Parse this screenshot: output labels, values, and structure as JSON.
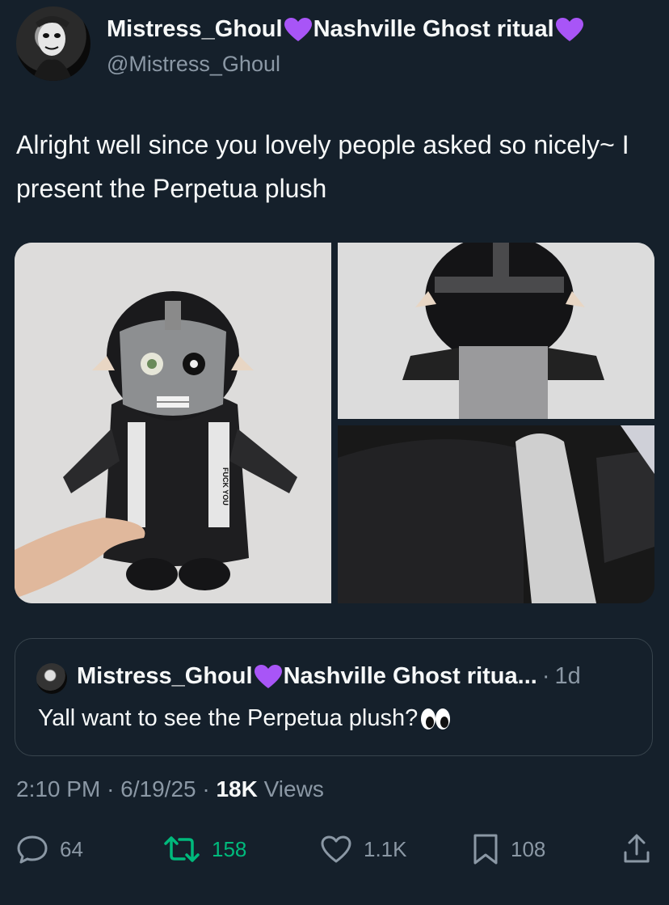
{
  "tweet": {
    "display_name": "Mistress_Ghoul",
    "display_name_suffix": "Nashville Ghost ritual",
    "handle": "@Mistress_Ghoul",
    "text": "Alright well since you lovely people asked so nicely~ I present the Perpetua plush",
    "timestamp": "2:10 PM",
    "date": "6/19/25",
    "views_count": "18K",
    "views_label": "Views"
  },
  "media": {
    "label_text": "FUCK YOU"
  },
  "quote": {
    "display_name": "Mistress_Ghoul",
    "display_name_suffix": "Nashville Ghost ritua...",
    "age": "1d",
    "text": "Yall want to see the Perpetua plush?"
  },
  "actions": {
    "replies": "64",
    "retweets": "158",
    "likes": "1.1K",
    "bookmarks": "108"
  },
  "colors": {
    "background": "#15202b",
    "text": "#f7f9f9",
    "secondary": "#8b98a5",
    "retweet_active": "#00ba7c",
    "heart_emoji": "#a855f7"
  }
}
